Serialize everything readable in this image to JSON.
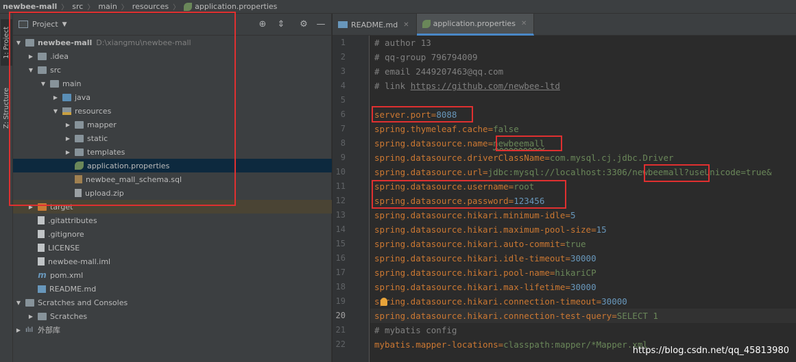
{
  "breadcrumb": [
    "newbee-mall",
    "src",
    "main",
    "resources",
    "application.properties"
  ],
  "toolstrip": {
    "project_tab": "1: Project",
    "structure_tab": "Z: Structure"
  },
  "panel": {
    "title": "Project"
  },
  "tree": [
    {
      "label": "newbee-mall",
      "extra": "D:\\xiangmu\\newbee-mall"
    },
    {
      "label": ".idea"
    },
    {
      "label": "src"
    },
    {
      "label": "main"
    },
    {
      "label": "java"
    },
    {
      "label": "resources"
    },
    {
      "label": "mapper"
    },
    {
      "label": "static"
    },
    {
      "label": "templates"
    },
    {
      "label": "application.properties"
    },
    {
      "label": "newbee_mall_schema.sql"
    },
    {
      "label": "upload.zip"
    },
    {
      "label": "target"
    },
    {
      "label": ".gitattributes"
    },
    {
      "label": ".gitignore"
    },
    {
      "label": "LICENSE"
    },
    {
      "label": "newbee-mall.iml"
    },
    {
      "label": "pom.xml"
    },
    {
      "label": "README.md"
    },
    {
      "label": "Scratches and Consoles"
    },
    {
      "label": "Scratches"
    },
    {
      "label": "外部库"
    }
  ],
  "tabs": [
    {
      "label": "README.md"
    },
    {
      "label": "application.properties"
    }
  ],
  "editor": {
    "current_line": 20,
    "lines": [
      {
        "n": "1",
        "key": "",
        "eq": "",
        "val": "",
        "comment": "# author 13"
      },
      {
        "n": "2",
        "key": "",
        "eq": "",
        "val": "",
        "comment": "# qq-group 796794009"
      },
      {
        "n": "3",
        "key": "",
        "eq": "",
        "val": "",
        "comment": "# email 2449207463@qq.com"
      },
      {
        "n": "4",
        "key": "",
        "eq": "",
        "val": "",
        "comment": "# link ",
        "link": "https://github.com/newbee-ltd"
      },
      {
        "n": "5",
        "key": "",
        "eq": "",
        "val": "",
        "comment": ""
      },
      {
        "n": "6",
        "key": "server.port",
        "eq": "=",
        "num": "8088"
      },
      {
        "n": "7",
        "key": "spring.thymeleaf.cache",
        "eq": "=",
        "val": "false"
      },
      {
        "n": "8",
        "key": "spring.datasource.name",
        "eq": "=",
        "val": "newbeemall"
      },
      {
        "n": "9",
        "key": "spring.datasource.driverClassName",
        "eq": "=",
        "val": "com.mysql.cj.jdbc.Driver"
      },
      {
        "n": "10",
        "key": "spring.datasource.url",
        "eq": "=",
        "val": "jdbc:mysql://localhost:3306/newbeemall?useUnicode=true&"
      },
      {
        "n": "11",
        "key": "spring.datasource.username",
        "eq": "=",
        "val": "root"
      },
      {
        "n": "12",
        "key": "spring.datasource.password",
        "eq": "=",
        "num": "123456"
      },
      {
        "n": "13",
        "key": "spring.datasource.hikari.minimum-idle",
        "eq": "=",
        "num": "5"
      },
      {
        "n": "14",
        "key": "spring.datasource.hikari.maximum-pool-size",
        "eq": "=",
        "num": "15"
      },
      {
        "n": "15",
        "key": "spring.datasource.hikari.auto-commit",
        "eq": "=",
        "val": "true"
      },
      {
        "n": "16",
        "key": "spring.datasource.hikari.idle-timeout",
        "eq": "=",
        "num": "30000"
      },
      {
        "n": "17",
        "key": "spring.datasource.hikari.pool-name",
        "eq": "=",
        "val": "hikariCP"
      },
      {
        "n": "18",
        "key": "spring.datasource.hikari.max-lifetime",
        "eq": "=",
        "num": "30000"
      },
      {
        "n": "19",
        "key": "spring.datasource.hikari.connection-timeout",
        "eq": "=",
        "num": "30000"
      },
      {
        "n": "20",
        "key": "spring.datasource.hikari.connection-test-query",
        "eq": "=",
        "val": "SELECT 1"
      },
      {
        "n": "21",
        "key": "",
        "eq": "",
        "val": "",
        "comment": "# mybatis config"
      },
      {
        "n": "22",
        "key": "mybatis.mapper-locations",
        "eq": "=",
        "val": "classpath:mapper/*Mapper.xml"
      }
    ]
  },
  "watermark": "https://blog.csdn.net/qq_45813980",
  "colors": {
    "highlight_box": "#e03030",
    "selection": "#0d293e",
    "accent": "#4a88c7"
  }
}
